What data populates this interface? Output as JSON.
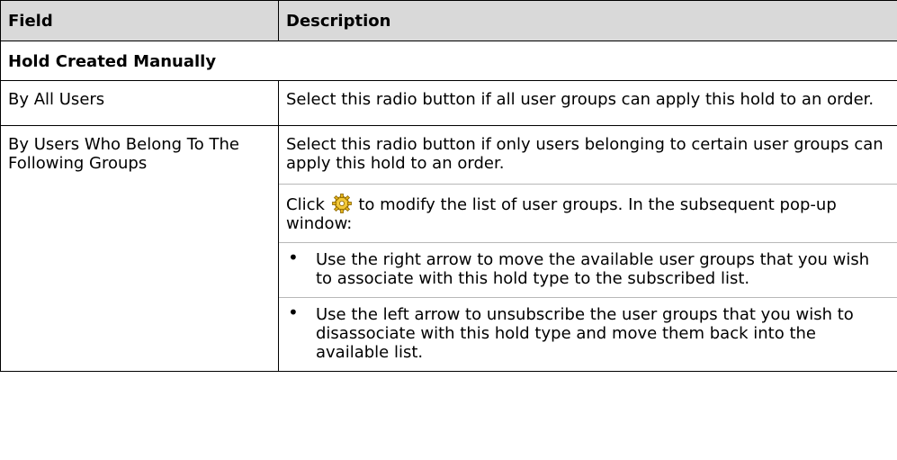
{
  "table": {
    "headers": [
      "Field",
      "Description"
    ],
    "section_title": "Hold Created Manually",
    "rows": [
      {
        "field": "By All Users",
        "description": "Select this radio button if all user groups can apply this hold to an order."
      },
      {
        "field": "By Users Who Belong To The Following Groups",
        "description": "Select this radio button if only users belonging to certain user groups can apply this hold to an order.",
        "click_prefix": "Click",
        "click_icon": "gear-icon",
        "click_suffix": "to modify the list of user groups. In the subsequent pop-up window:",
        "bullets": [
          "Use the right arrow to move the available user groups that you wish to associate with this hold type to the subscribed list.",
          "Use the left arrow to unsubscribe the user groups that you wish to disassociate with this hold type and move them back into the available list."
        ]
      }
    ]
  },
  "colors": {
    "header_background": "#d9d9d9",
    "border": "#000000",
    "icon_accent": "#d9a400"
  }
}
